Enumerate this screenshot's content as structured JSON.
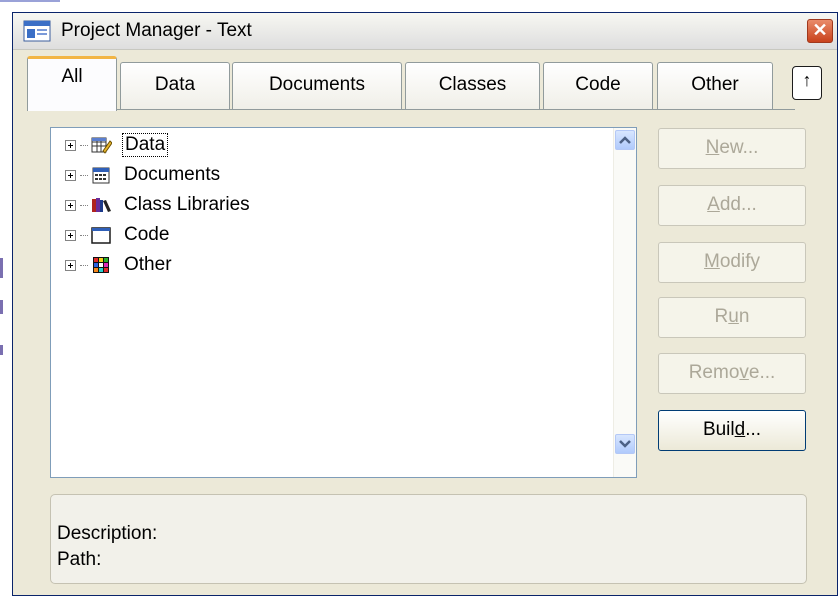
{
  "window": {
    "title": "Project Manager - Text",
    "close_glyph": "✕"
  },
  "tabs": [
    {
      "label": "All",
      "active": true
    },
    {
      "label": "Data"
    },
    {
      "label": "Documents"
    },
    {
      "label": "Classes"
    },
    {
      "label": "Code"
    },
    {
      "label": "Other"
    }
  ],
  "tab_collapse_glyph": "↑",
  "tree": {
    "items": [
      {
        "label": "Data",
        "icon": "data-icon",
        "selected": true
      },
      {
        "label": "Documents",
        "icon": "documents-icon"
      },
      {
        "label": "Class Libraries",
        "icon": "class-libraries-icon"
      },
      {
        "label": "Code",
        "icon": "code-icon"
      },
      {
        "label": "Other",
        "icon": "other-icon"
      }
    ]
  },
  "buttons": {
    "new": {
      "label": "New...",
      "mnemonic": "N",
      "enabled": false
    },
    "add": {
      "label": "Add...",
      "mnemonic": "A",
      "enabled": false
    },
    "modify": {
      "label": "Modify",
      "mnemonic": "M",
      "enabled": false
    },
    "run": {
      "label": "Run",
      "mnemonic": "u",
      "enabled": false
    },
    "remove": {
      "label": "Remove...",
      "mnemonic": "v",
      "enabled": false
    },
    "build": {
      "label": "Build...",
      "mnemonic": "d",
      "enabled": true
    }
  },
  "description": {
    "description_label": "Description:",
    "path_label": "Path:"
  },
  "colors": {
    "accent_tab": "#f2b544",
    "close_button": "#c9421c",
    "disabled_text": "#aca899"
  }
}
